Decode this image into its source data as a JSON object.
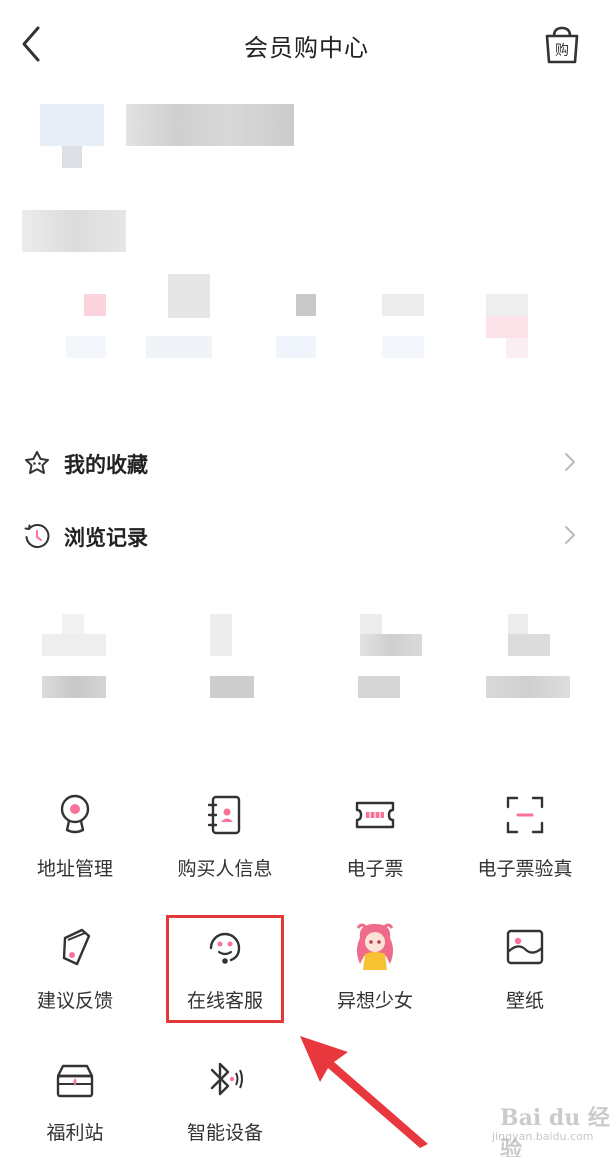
{
  "header": {
    "title": "会员购中心",
    "bag_glyph": "购"
  },
  "rows": [
    {
      "label": "我的收藏",
      "icon": "star-icon"
    },
    {
      "label": "浏览记录",
      "icon": "history-icon"
    }
  ],
  "services": [
    {
      "label": "地址管理",
      "icon": "location-icon"
    },
    {
      "label": "购买人信息",
      "icon": "contact-book-icon"
    },
    {
      "label": "电子票",
      "icon": "ticket-icon"
    },
    {
      "label": "电子票验真",
      "icon": "scan-icon"
    },
    {
      "label": "建议反馈",
      "icon": "feedback-icon"
    },
    {
      "label": "在线客服",
      "icon": "customer-service-icon"
    },
    {
      "label": "异想少女",
      "icon": "anime-girl-icon"
    },
    {
      "label": "壁纸",
      "icon": "wallpaper-icon"
    },
    {
      "label": "福利站",
      "icon": "gift-box-icon"
    },
    {
      "label": "智能设备",
      "icon": "bluetooth-icon"
    }
  ],
  "watermark": {
    "text": "Bai du 经验",
    "url": "jingyan.baidu.com"
  },
  "colors": {
    "accent": "#fb7299",
    "highlight": "#e23a3a",
    "arrow": "#e8383d"
  }
}
